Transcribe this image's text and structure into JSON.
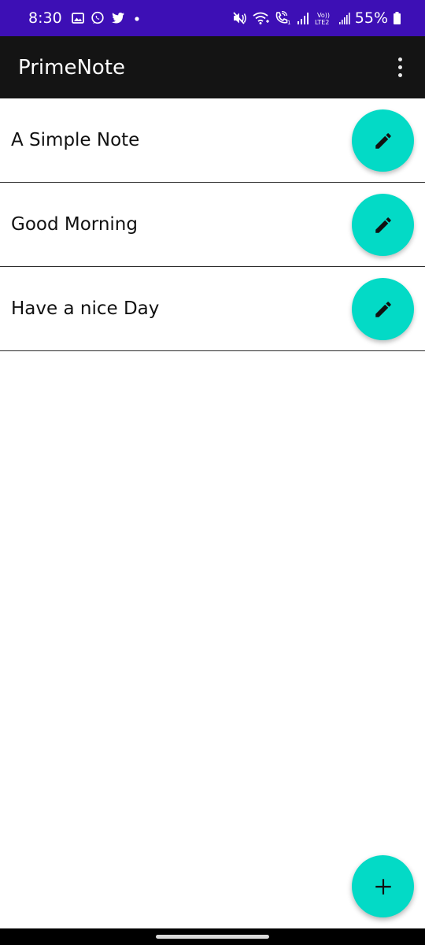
{
  "status_bar": {
    "time": "8:30",
    "battery_percent": "55%",
    "network_label": "Vo)) LTE2",
    "colors": {
      "background": "#3d0fb5",
      "text": "#ffffff"
    },
    "icons": [
      "gallery-icon",
      "whatsapp-icon",
      "twitter-icon",
      "notification-dot-icon",
      "mute-icon",
      "wifi-icon",
      "wifi-calling-icon",
      "signal-icon",
      "battery-icon"
    ]
  },
  "app_bar": {
    "title": "PrimeNote",
    "background": "#141414",
    "overflow_icon": "more-vert-icon"
  },
  "notes": [
    {
      "title": "A Simple Note",
      "action_icon": "edit-pencil-icon"
    },
    {
      "title": "Good Morning",
      "action_icon": "edit-pencil-icon"
    },
    {
      "title": "Have a nice Day",
      "action_icon": "edit-pencil-icon"
    }
  ],
  "fab": {
    "icon": "add-icon",
    "color": "#03dac6"
  }
}
